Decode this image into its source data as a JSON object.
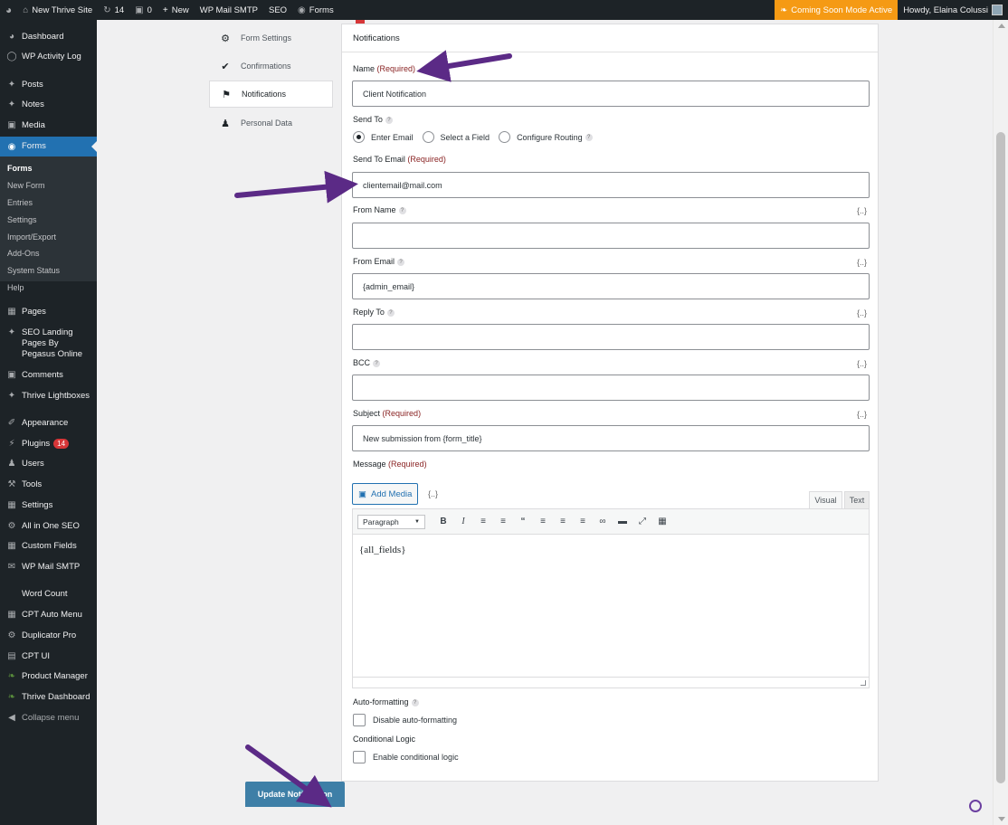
{
  "admin_bar": {
    "site_name": "New Thrive Site",
    "updates_count": "14",
    "comments_count": "0",
    "new_label": "New",
    "wp_mail_smtp": "WP Mail SMTP",
    "seo": "SEO",
    "forms": "Forms",
    "coming_soon": "Coming Soon Mode Active",
    "howdy": "Howdy, Elaina Colussi"
  },
  "sidebar": {
    "items": [
      {
        "label": "Dashboard",
        "icon": "dashboard-icon"
      },
      {
        "label": "WP Activity Log",
        "icon": "activity-log-icon"
      },
      {
        "label": "Posts",
        "icon": "pin-icon"
      },
      {
        "label": "Notes",
        "icon": "pin-icon"
      },
      {
        "label": "Media",
        "icon": "media-icon"
      },
      {
        "label": "Forms",
        "icon": "forms-icon"
      },
      {
        "label": "Pages",
        "icon": "pages-icon"
      },
      {
        "label": "SEO Landing Pages By Pegasus Online",
        "icon": "pin-icon"
      },
      {
        "label": "Comments",
        "icon": "comments-icon"
      },
      {
        "label": "Thrive Lightboxes",
        "icon": "pin-icon"
      },
      {
        "label": "Appearance",
        "icon": "brush-icon"
      },
      {
        "label": "Plugins",
        "icon": "plugins-icon",
        "badge": "14"
      },
      {
        "label": "Users",
        "icon": "users-icon"
      },
      {
        "label": "Tools",
        "icon": "tools-icon"
      },
      {
        "label": "Settings",
        "icon": "settings-icon"
      },
      {
        "label": "All in One SEO",
        "icon": "seo-icon"
      },
      {
        "label": "Custom Fields",
        "icon": "custom-fields-icon"
      },
      {
        "label": "WP Mail SMTP",
        "icon": "mail-icon"
      },
      {
        "label": "Word Count",
        "icon": ""
      },
      {
        "label": "CPT Auto Menu",
        "icon": "grid-icon"
      },
      {
        "label": "Duplicator Pro",
        "icon": "duplicator-icon"
      },
      {
        "label": "CPT UI",
        "icon": "cpt-icon"
      },
      {
        "label": "Product Manager",
        "icon": "leaf-icon"
      },
      {
        "label": "Thrive Dashboard",
        "icon": "leaf-icon"
      },
      {
        "label": "Collapse menu",
        "icon": "collapse-icon"
      }
    ],
    "submenu": [
      "Forms",
      "New Form",
      "Entries",
      "Settings",
      "Import/Export",
      "Add-Ons",
      "System Status",
      "Help"
    ]
  },
  "settings_nav": [
    "Form Settings",
    "Confirmations",
    "Notifications",
    "Personal Data"
  ],
  "panel": {
    "title": "Notifications",
    "required": "(Required)",
    "merge_tag": "{..}",
    "name_label": "Name",
    "name_value": "Client Notification",
    "send_to_label": "Send To",
    "send_to_options": [
      "Enter Email",
      "Select a Field",
      "Configure Routing"
    ],
    "send_to_email_label": "Send To Email",
    "send_to_email_value": "clientemail@mail.com",
    "from_name_label": "From Name",
    "from_name_value": "",
    "from_email_label": "From Email",
    "from_email_value": "{admin_email}",
    "reply_to_label": "Reply To",
    "reply_to_value": "",
    "bcc_label": "BCC",
    "bcc_value": "",
    "subject_label": "Subject",
    "subject_value": "New submission from {form_title}",
    "message_label": "Message",
    "add_media": "Add Media",
    "tab_visual": "Visual",
    "tab_text": "Text",
    "format_select": "Paragraph",
    "editor_content": "{all_fields}",
    "autoformat_label": "Auto-formatting",
    "autoformat_checkbox": "Disable auto-formatting",
    "conditional_label": "Conditional Logic",
    "conditional_checkbox": "Enable conditional logic"
  },
  "update_button": "Update Notification",
  "colors": {
    "admin_dark": "#1d2327",
    "accent_blue": "#2271b1",
    "required_red": "#8a2424",
    "coming_soon_orange": "#f59a14",
    "arrow_purple": "#5b2a86"
  }
}
